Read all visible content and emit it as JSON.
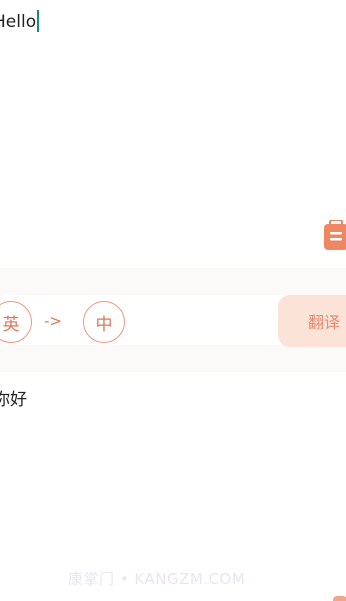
{
  "input": {
    "text": "Hello"
  },
  "language_switch": {
    "source": "英",
    "arrow": "->",
    "target": "中"
  },
  "translate_button": {
    "label": "翻译"
  },
  "output": {
    "text": "你好"
  },
  "watermark": {
    "text": "康掌门 • KANGZM.COM"
  },
  "icons": {
    "clipboard": "clipboard-icon"
  },
  "colors": {
    "accent": "#e0765a",
    "accent_light": "#fbe3d8",
    "caret": "#1a8a7a"
  }
}
